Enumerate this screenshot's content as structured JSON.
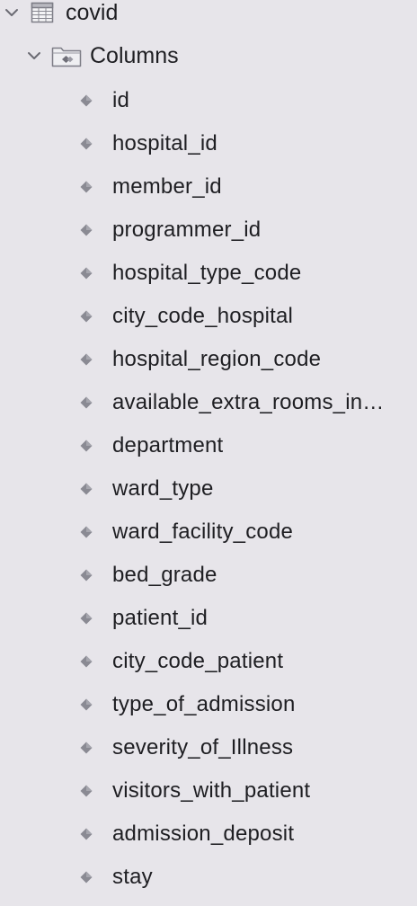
{
  "tree": {
    "table": {
      "name": "covid",
      "expanded": true,
      "icon": "table-icon"
    },
    "folder": {
      "name": "Columns",
      "expanded": true,
      "icon": "columns-folder-icon"
    },
    "columns": [
      "id",
      "hospital_id",
      "member_id",
      "programmer_id",
      "hospital_type_code",
      "city_code_hospital",
      "hospital_region_code",
      "available_extra_rooms_in…",
      "department",
      "ward_type",
      "ward_facility_code",
      "bed_grade",
      "patient_id",
      "city_code_patient",
      "type_of_admission",
      "severity_of_Illness",
      "visitors_with_patient",
      "admission_deposit",
      "stay"
    ]
  },
  "colors": {
    "background": "#e7e5ea",
    "text": "#1e1e22",
    "icon_gray": "#8a8a93"
  }
}
